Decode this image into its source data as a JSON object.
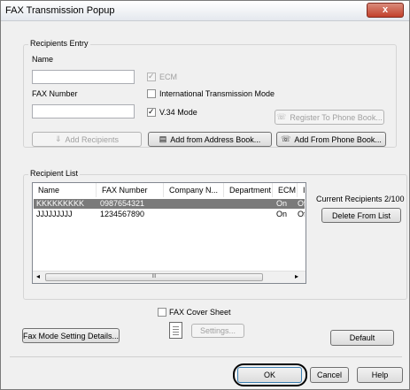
{
  "window": {
    "title": "FAX Transmission Popup",
    "close_glyph": "x"
  },
  "recipients_entry": {
    "legend": "Recipients Entry",
    "name_label": "Name",
    "name_value": "",
    "fax_number_label": "FAX Number",
    "fax_number_value": "",
    "ecm": {
      "label": "ECM",
      "checked": true,
      "enabled": false
    },
    "intl_mode": {
      "label": "International Transmission Mode",
      "checked": false
    },
    "v34_mode": {
      "label": "V.34 Mode",
      "checked": true
    },
    "register_button": "Register To Phone Book...",
    "add_recipients_button": "Add Recipients",
    "add_from_address_book_button": "Add from Address Book...",
    "add_from_phone_book_button": "Add From Phone Book..."
  },
  "recipient_list": {
    "legend": "Recipient List",
    "columns": [
      "Name",
      "FAX Number",
      "Company N...",
      "Department",
      "ECM",
      "I"
    ],
    "rows": [
      {
        "name": "KKKKKKKKK",
        "fax": "0987654321",
        "company": "",
        "department": "",
        "ecm": "On",
        "intl": "Of",
        "selected": true
      },
      {
        "name": "JJJJJJJJJ",
        "fax": "1234567890",
        "company": "",
        "department": "",
        "ecm": "On",
        "intl": "Of",
        "selected": false
      }
    ],
    "current_recipients": "Current Recipients 2/100",
    "delete_button": "Delete From List",
    "scroll_grip": "III"
  },
  "cover_sheet": {
    "label": "FAX Cover Sheet",
    "checked": false,
    "settings_button": "Settings..."
  },
  "fax_mode_button": "Fax Mode Setting Details...",
  "default_button": "Default",
  "ok_button": "OK",
  "cancel_button": "Cancel",
  "help_button": "Help",
  "colors": {
    "selection": "#7a7a7a",
    "ok_highlight": "#000000"
  }
}
